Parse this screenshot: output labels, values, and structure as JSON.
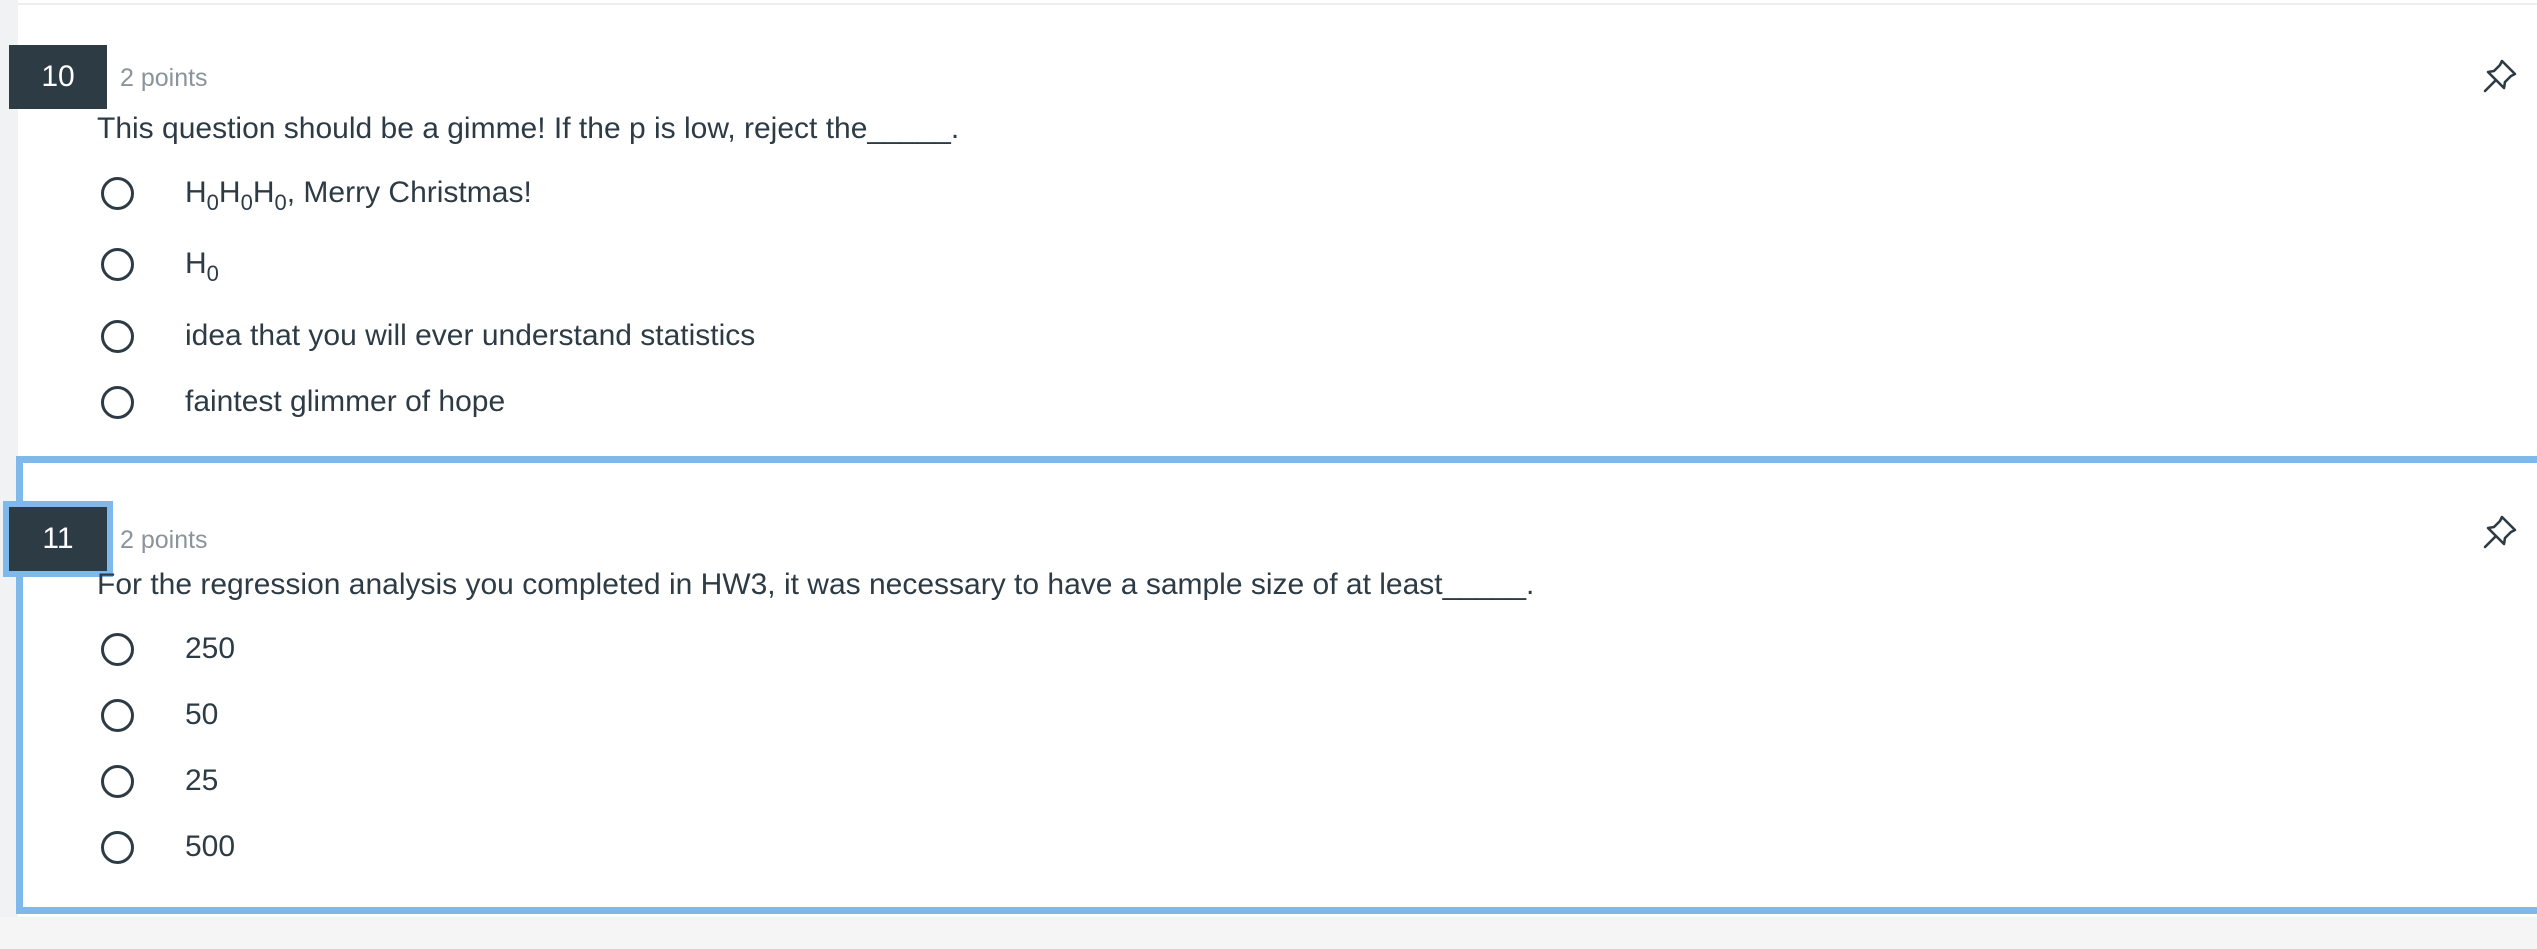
{
  "questions": [
    {
      "number": "10",
      "points": "2 points",
      "text": "This question should be a gimme! If the p is low, reject the_____.",
      "pin_icon": "pushpin-icon",
      "answers": [
        {
          "label": "H0H0H0, Merry Christmas!"
        },
        {
          "label": "H0"
        },
        {
          "label": "idea that you will ever understand statistics"
        },
        {
          "label": "faintest glimmer of hope"
        }
      ]
    },
    {
      "number": "11",
      "points": "2 points",
      "text": "For the regression analysis you completed in HW3, it was necessary to have a sample size of at least_____.",
      "pin_icon": "pushpin-icon",
      "answers": [
        {
          "label": "250"
        },
        {
          "label": "50"
        },
        {
          "label": "25"
        },
        {
          "label": "500"
        }
      ]
    }
  ],
  "colors": {
    "number_badge": "#2d3b45",
    "focus_border": "#7fb8eb",
    "points_text": "#8a949b",
    "body_text": "#2d3b45"
  }
}
